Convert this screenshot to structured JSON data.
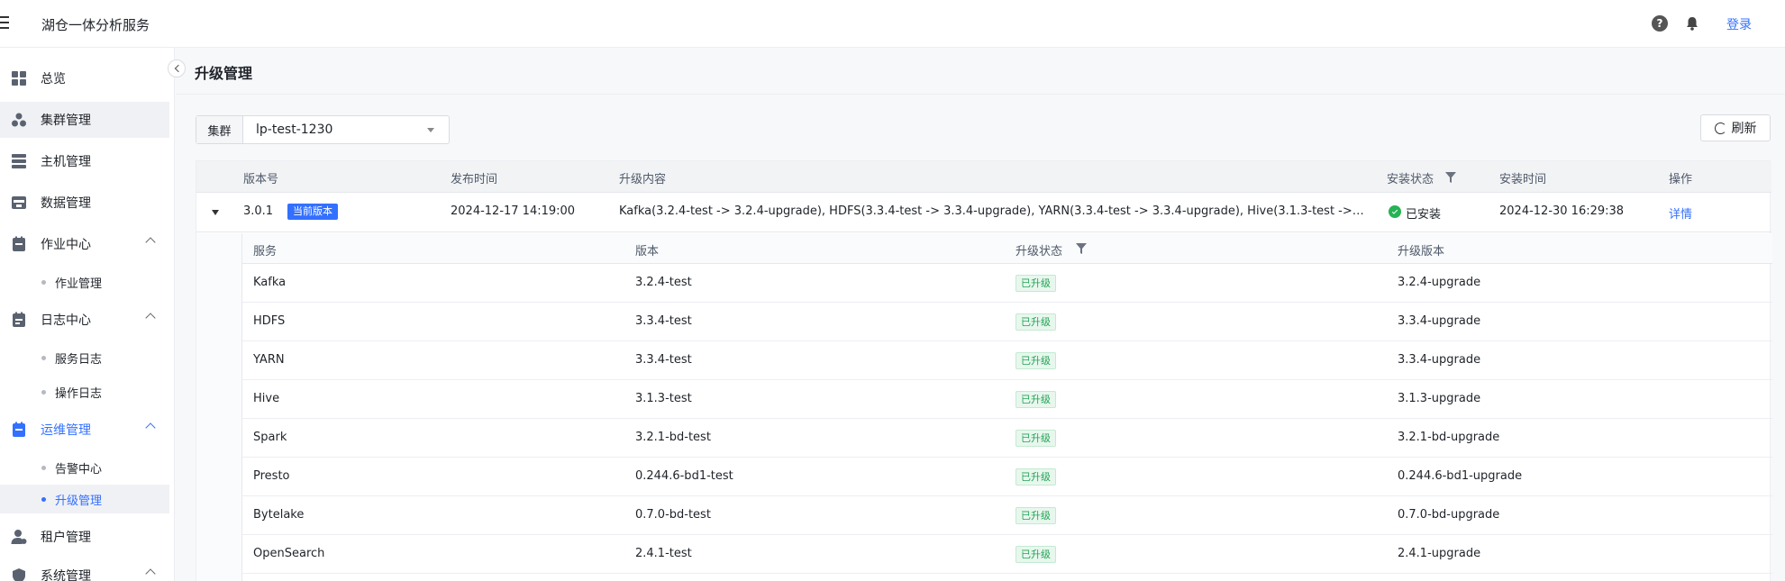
{
  "header": {
    "app_title": "湖仓一体分析服务",
    "help_symbol": "?",
    "login": "登录"
  },
  "sidebar": {
    "items": [
      {
        "label": "总览",
        "icon": "dashboard-icon"
      },
      {
        "label": "集群管理",
        "icon": "cluster-icon"
      },
      {
        "label": "主机管理",
        "icon": "server-icon"
      },
      {
        "label": "数据管理",
        "icon": "database-icon"
      },
      {
        "label": "作业中心",
        "icon": "job-icon"
      },
      {
        "label": "日志中心",
        "icon": "log-icon"
      },
      {
        "label": "运维管理",
        "icon": "ops-icon"
      },
      {
        "label": "租户管理",
        "icon": "tenant-icon"
      },
      {
        "label": "系统管理",
        "icon": "system-icon"
      }
    ],
    "sub_items": {
      "job": [
        "作业管理"
      ],
      "log": [
        "服务日志",
        "操作日志"
      ],
      "ops": [
        "告警中心",
        "升级管理"
      ]
    }
  },
  "main": {
    "page_title": "升级管理",
    "cluster_label": "集群",
    "cluster_value": "lp-test-1230",
    "refresh_label": "刷新"
  },
  "table": {
    "columns": [
      "版本号",
      "发布时间",
      "升级内容",
      "安装状态",
      "安装时间",
      "操作"
    ],
    "row": {
      "version": "3.0.1",
      "current_tag": "当前版本",
      "release_time": "2024-12-17 14:19:00",
      "content": "Kafka(3.2.4-test -> 3.2.4-upgrade), HDFS(3.3.4-test -> 3.3.4-upgrade), YARN(3.3.4-test -> 3.3.4-upgrade), Hive(3.1.3-test -> ...",
      "install_status": "已安装",
      "install_time": "2024-12-30 16:29:38",
      "action": "详情"
    },
    "sub_columns": [
      "服务",
      "版本",
      "升级状态",
      "升级版本"
    ],
    "sub_rows": [
      {
        "service": "Kafka",
        "version": "3.2.4-test",
        "status": "已升级",
        "upgrade": "3.2.4-upgrade"
      },
      {
        "service": "HDFS",
        "version": "3.3.4-test",
        "status": "已升级",
        "upgrade": "3.3.4-upgrade"
      },
      {
        "service": "YARN",
        "version": "3.3.4-test",
        "status": "已升级",
        "upgrade": "3.3.4-upgrade"
      },
      {
        "service": "Hive",
        "version": "3.1.3-test",
        "status": "已升级",
        "upgrade": "3.1.3-upgrade"
      },
      {
        "service": "Spark",
        "version": "3.2.1-bd-test",
        "status": "已升级",
        "upgrade": "3.2.1-bd-upgrade"
      },
      {
        "service": "Presto",
        "version": "0.244.6-bd1-test",
        "status": "已升级",
        "upgrade": "0.244.6-bd1-upgrade"
      },
      {
        "service": "Bytelake",
        "version": "0.7.0-bd-test",
        "status": "已升级",
        "upgrade": "0.7.0-bd-upgrade"
      },
      {
        "service": "OpenSearch",
        "version": "2.4.1-test",
        "status": "已升级",
        "upgrade": "2.4.1-upgrade"
      }
    ]
  },
  "colors": {
    "accent": "#3370ff",
    "success": "#27b254"
  }
}
